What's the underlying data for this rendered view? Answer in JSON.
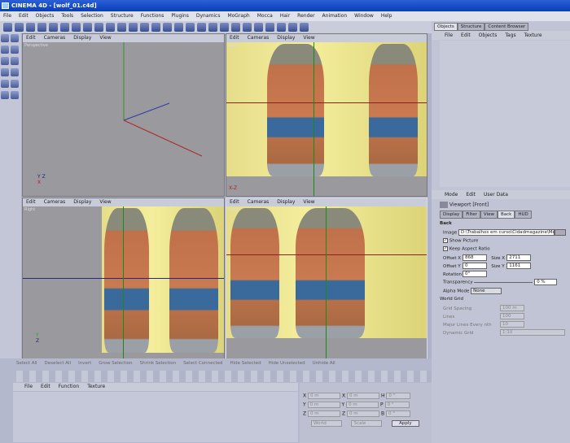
{
  "window": {
    "title": "CINEMA 4D - [wolf_01.c4d]"
  },
  "menu": [
    "File",
    "Edit",
    "Objects",
    "Tools",
    "Selection",
    "Structure",
    "Functions",
    "Plugins",
    "Dynamics",
    "MoGraph",
    "Mocca",
    "Hair",
    "Render",
    "Animation",
    "Window",
    "Help"
  ],
  "viewports": [
    {
      "title": "Perspective",
      "menu": [
        "Edit",
        "Cameras",
        "Display",
        "View"
      ]
    },
    {
      "title": "Back",
      "menu": [
        "Edit",
        "Cameras",
        "Display",
        "View"
      ]
    },
    {
      "title": "Right",
      "menu": [
        "Edit",
        "Cameras",
        "Display",
        "View"
      ]
    },
    {
      "title": "Front",
      "menu": [
        "Edit",
        "Cameras",
        "Display",
        "View"
      ]
    }
  ],
  "axis": {
    "x": "X",
    "y": "Y",
    "z": "Z"
  },
  "objects_panel": {
    "tabs": [
      "Objects",
      "Structure",
      "Content Browser"
    ],
    "menu": [
      "File",
      "Edit",
      "Objects",
      "Tags",
      "Texture"
    ]
  },
  "attributes": {
    "menu": [
      "Mode",
      "Edit",
      "User Data"
    ],
    "object": "Viewport [Front]",
    "tabs": [
      "Display",
      "Filter",
      "View",
      "Back",
      "HUD"
    ],
    "active_tab": "Back",
    "section": "Back",
    "image_label": "Image",
    "image_value": "D:\\Trabalhos em curso\\Cidadmagazine\\Mex",
    "show_picture": "Show Picture",
    "keep_aspect": "Keep Aspect Ratio",
    "offset_x_label": "Offset X",
    "offset_x": "868",
    "size_x_label": "Size X",
    "size_x": "2711",
    "offset_y_label": "Offset Y",
    "offset_y": "0",
    "size_y_label": "Size Y",
    "size_y": "1161",
    "rotation_label": "Rotation",
    "rotation": "0°",
    "transparency_label": "Transparency",
    "transparency": "0 %",
    "alpha_label": "Alpha Mode",
    "alpha": "None",
    "grid_section": "World Grid",
    "grid_spacing_label": "Grid Spacing",
    "grid_spacing": "100 m",
    "lines_label": "Lines",
    "lines": "100",
    "major_label": "Major Lines Every nth",
    "major": "10",
    "dynamic_label": "Dynamic Grid",
    "dynamic": "1:10"
  },
  "commands": [
    "Select All",
    "Deselect All",
    "Invert",
    "Grow Selection",
    "Shrink Selection",
    "Select Connected",
    "Hide Selected",
    "Hide Unselected",
    "Unhide All"
  ],
  "material_menu": [
    "File",
    "Edit",
    "Function",
    "Texture"
  ],
  "coords": {
    "rows": [
      [
        "X",
        "0 m",
        "X",
        "0 m",
        "H",
        "0 °"
      ],
      [
        "Y",
        "0 m",
        "Y",
        "0 m",
        "P",
        "0 °"
      ],
      [
        "Z",
        "0 m",
        "Z",
        "0 m",
        "B",
        "0 °"
      ]
    ],
    "mode1": "World",
    "mode2": "Scale",
    "apply": "Apply"
  }
}
